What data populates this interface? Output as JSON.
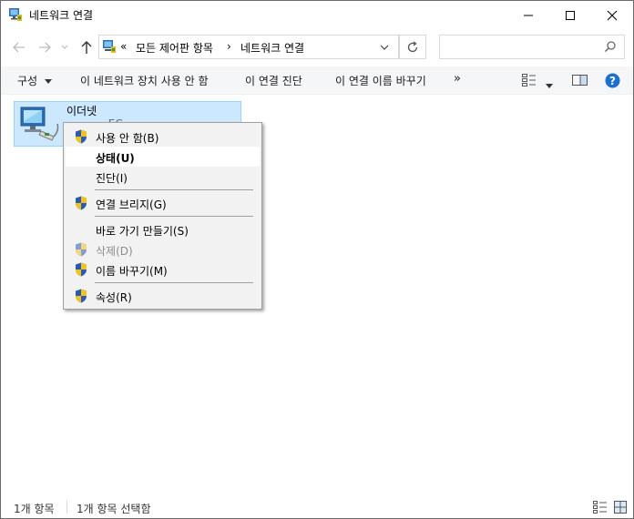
{
  "window": {
    "title": "네트워크 연결"
  },
  "address_bar": {
    "overflow": "«",
    "crumbs": [
      "모든 제어판 항목",
      "네트워크 연결"
    ],
    "separator": "›",
    "search_placeholder": ""
  },
  "toolbar": {
    "organize": "구성",
    "disable": "이 네트워크 장치 사용 안 함",
    "diagnose": "이 연결 진단",
    "rename": "이 연결 이름 바꾸기",
    "more": "»"
  },
  "items": [
    {
      "name": "이더넷",
      "sub": "...  ...  ... EC"
    }
  ],
  "context_menu": {
    "items": [
      {
        "label": "사용 안 함(B)",
        "shield": true
      },
      {
        "label": "상태(U)",
        "bold": true,
        "highlighted": true
      },
      {
        "label": "진단(I)"
      },
      {
        "label": "연결 브리지(G)",
        "shield": true
      },
      {
        "label": "바로 가기 만들기(S)"
      },
      {
        "label": "삭제(D)",
        "shield": true,
        "disabled": true
      },
      {
        "label": "이름 바꾸기(M)",
        "shield": true
      },
      {
        "label": "속성(R)",
        "shield": true
      }
    ]
  },
  "status_bar": {
    "count": "1개 항목",
    "selected": "1개 항목 선택함"
  },
  "colors": {
    "selection_bg": "#cce8ff",
    "selection_border": "#99d1ff",
    "help_blue": "#1a6fd1",
    "shield_blue": "#2a5bb4",
    "shield_yellow": "#f2c21d"
  }
}
